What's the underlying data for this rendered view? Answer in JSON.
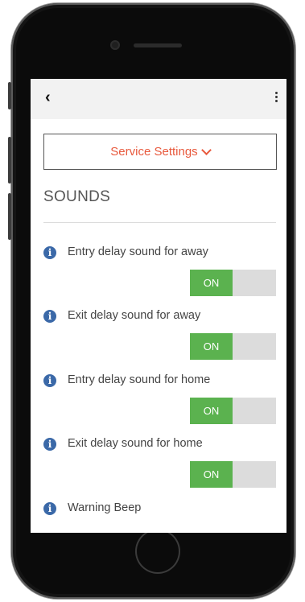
{
  "header": {
    "back_glyph": "‹",
    "menu_icon": "more-vertical-icon"
  },
  "service_dropdown": {
    "label": "Service Settings"
  },
  "section": {
    "title": "SOUNDS"
  },
  "colors": {
    "accent": "#e8593d",
    "toggle_on": "#5bb24f",
    "info": "#3b69a8"
  },
  "settings": [
    {
      "label": "Entry delay sound for away",
      "toggle": "ON"
    },
    {
      "label": "Exit delay sound for away",
      "toggle": "ON"
    },
    {
      "label": "Entry delay sound for home",
      "toggle": "ON"
    },
    {
      "label": "Exit delay sound for home",
      "toggle": "ON"
    },
    {
      "label": "Warning Beep"
    }
  ]
}
